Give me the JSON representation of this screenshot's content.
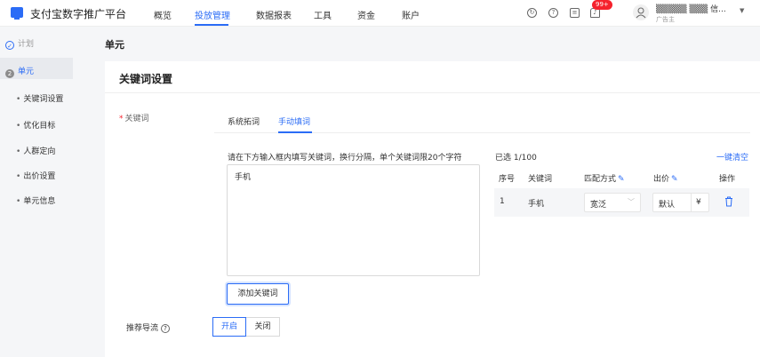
{
  "header": {
    "brand": "支付宝数字推广平台",
    "nav": [
      "概览",
      "投放管理",
      "数据报表",
      "工具",
      "资金",
      "账户"
    ],
    "active_nav": "投放管理",
    "notification_count": "99+",
    "user_name": "▒▒▒▒▒ ▒▒▒ 信...",
    "user_role": "广告主"
  },
  "sidebar": {
    "steps": [
      {
        "num": "",
        "label": "计划"
      },
      {
        "num": "2",
        "label": "单元"
      }
    ],
    "sub_items": [
      "关键词设置",
      "优化目标",
      "人群定向",
      "出价设置",
      "单元信息"
    ]
  },
  "main": {
    "breadcrumb_title": "单元",
    "card_title": "关键词设置",
    "keyword_label": "关键词",
    "tabs": [
      "系统拓词",
      "手动填词"
    ],
    "active_tab": "手动填词",
    "hint": "请在下方输入框内填写关键词，换行分隔，单个关键词限20个字符",
    "textarea_value": "手机",
    "add_button": "添加关键词",
    "selected_count": "已选 1/100",
    "clear_all": "一键清空",
    "table": {
      "headers": [
        "序号",
        "关键词",
        "匹配方式",
        "出价",
        "操作"
      ],
      "rows": [
        {
          "index": "1",
          "keyword": "手机",
          "match": "宽泛",
          "bid": "默认",
          "currency": "¥"
        }
      ]
    },
    "recommend_label": "推荐导流",
    "toggle": [
      "开启",
      "关闭"
    ],
    "toggle_selected": "开启"
  },
  "colors": {
    "accent": "#2b6cf6",
    "danger": "#f5222d"
  }
}
